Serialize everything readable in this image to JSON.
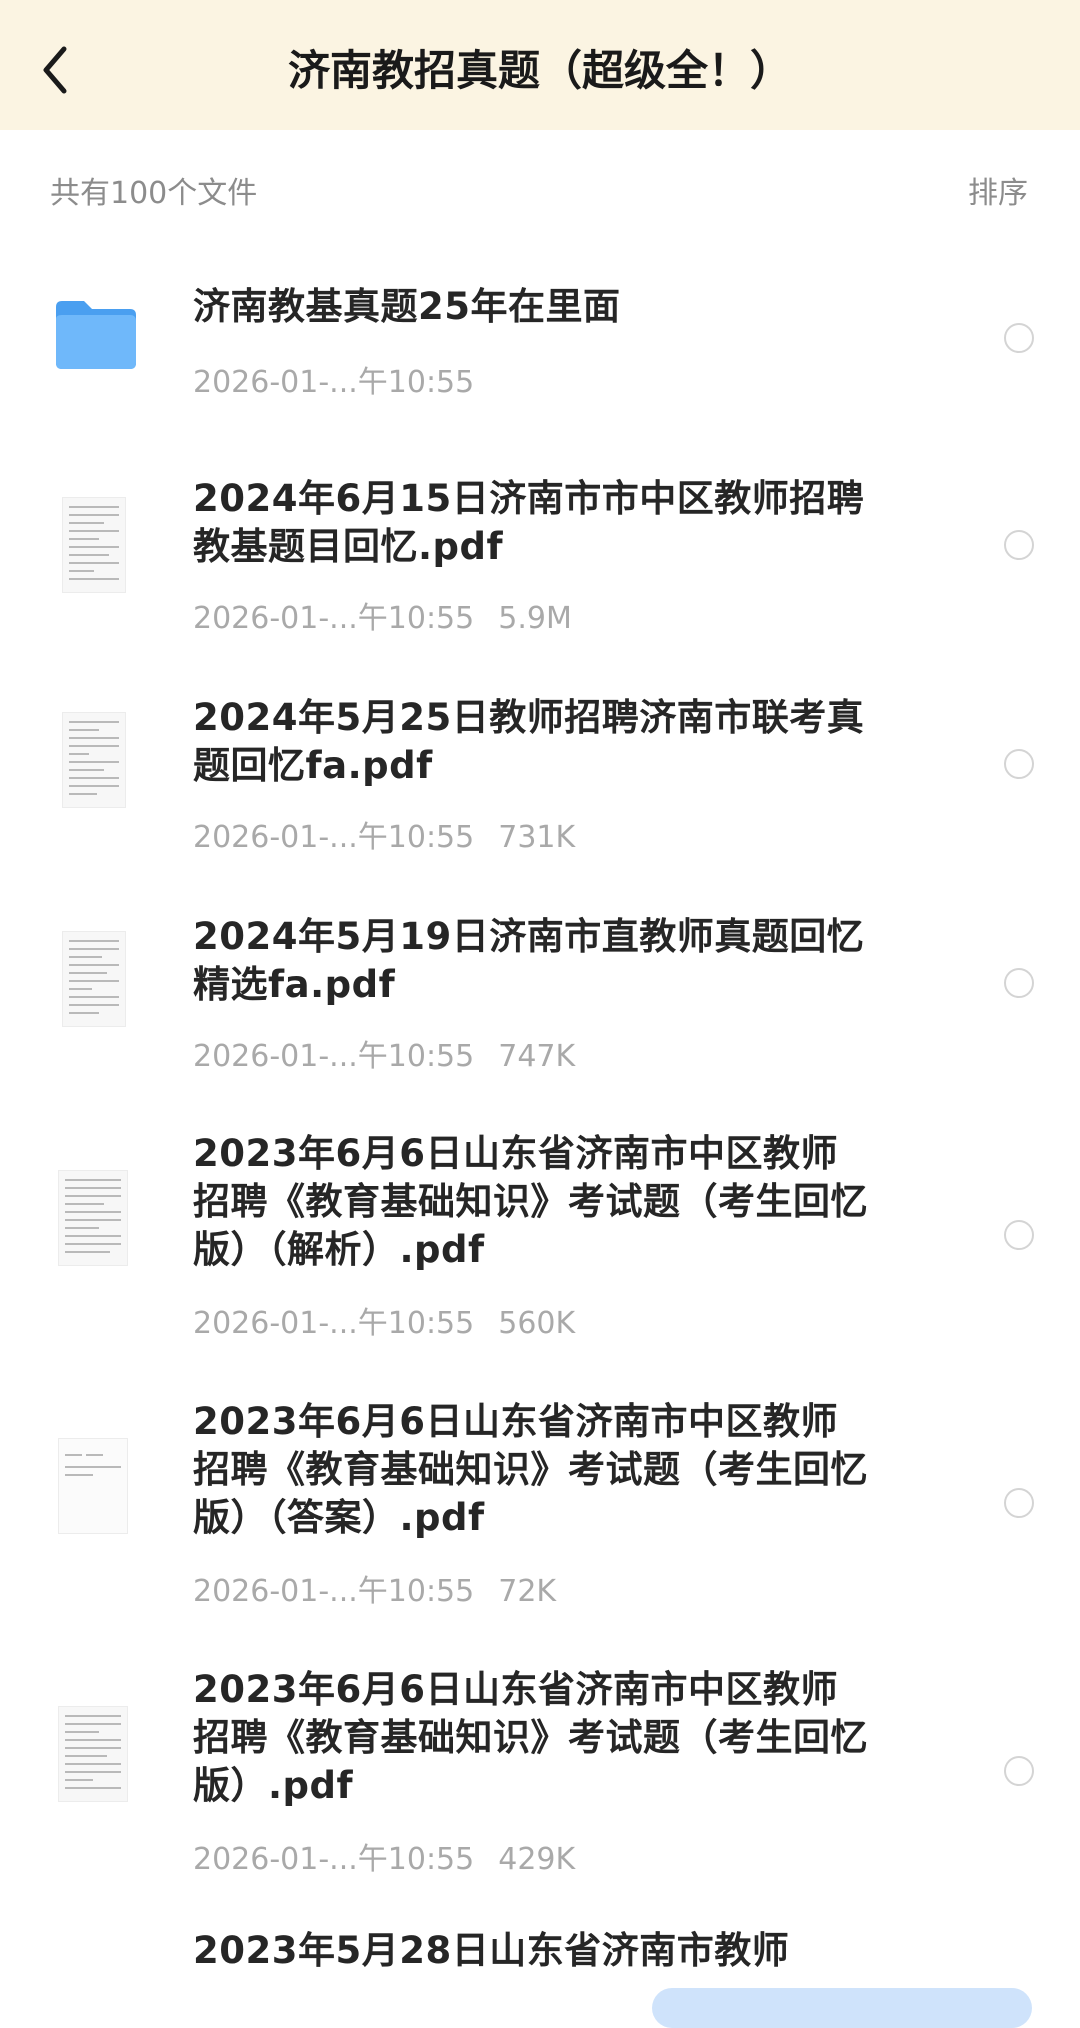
{
  "header": {
    "title": "济南教招真题（超级全！）",
    "background": "#fbf4e2"
  },
  "toolbar": {
    "file_count": "共有100个文件",
    "sort_label": "排序"
  },
  "files": [
    {
      "type": "folder",
      "icon": "folder-icon",
      "name": "济南教基真题25年在里面",
      "date": "2026-01-...午10:55",
      "size": ""
    },
    {
      "type": "pdf",
      "icon": "document-thumbnail",
      "name": "2024年6月15日济南市市中区教师招聘教基题目回忆.pdf",
      "date": "2026-01-...午10:55",
      "size": "5.9M"
    },
    {
      "type": "pdf",
      "icon": "document-thumbnail",
      "name": "2024年5月25日教师招聘济南市联考真题回忆fa.pdf",
      "date": "2026-01-...午10:55",
      "size": "731K"
    },
    {
      "type": "pdf",
      "icon": "document-thumbnail",
      "name": "2024年5月19日济南市直教师真题回忆精选fa.pdf",
      "date": "2026-01-...午10:55",
      "size": "747K"
    },
    {
      "type": "pdf",
      "icon": "document-thumbnail",
      "name": "2023年6月6日山东省济南市中区教师招聘《教育基础知识》考试题（考生回忆版）（解析）.pdf",
      "date": "2026-01-...午10:55",
      "size": "560K"
    },
    {
      "type": "pdf",
      "icon": "document-thumbnail",
      "name": "2023年6月6日山东省济南市中区教师招聘《教育基础知识》考试题（考生回忆版）（答案）.pdf",
      "date": "2026-01-...午10:55",
      "size": "72K"
    },
    {
      "type": "pdf",
      "icon": "document-thumbnail",
      "name": "2023年6月6日山东省济南市中区教师招聘《教育基础知识》考试题（考生回忆版）.pdf",
      "date": "2026-01-...午10:55",
      "size": "429K"
    },
    {
      "type": "pdf",
      "icon": "document-thumbnail",
      "name": "2023年5月28日山东省济南市教师",
      "date": "",
      "size": ""
    }
  ],
  "colors": {
    "folder": "#5aaaf5",
    "meta_text": "#a9a9a9",
    "radio_border": "#d4d4d4"
  }
}
